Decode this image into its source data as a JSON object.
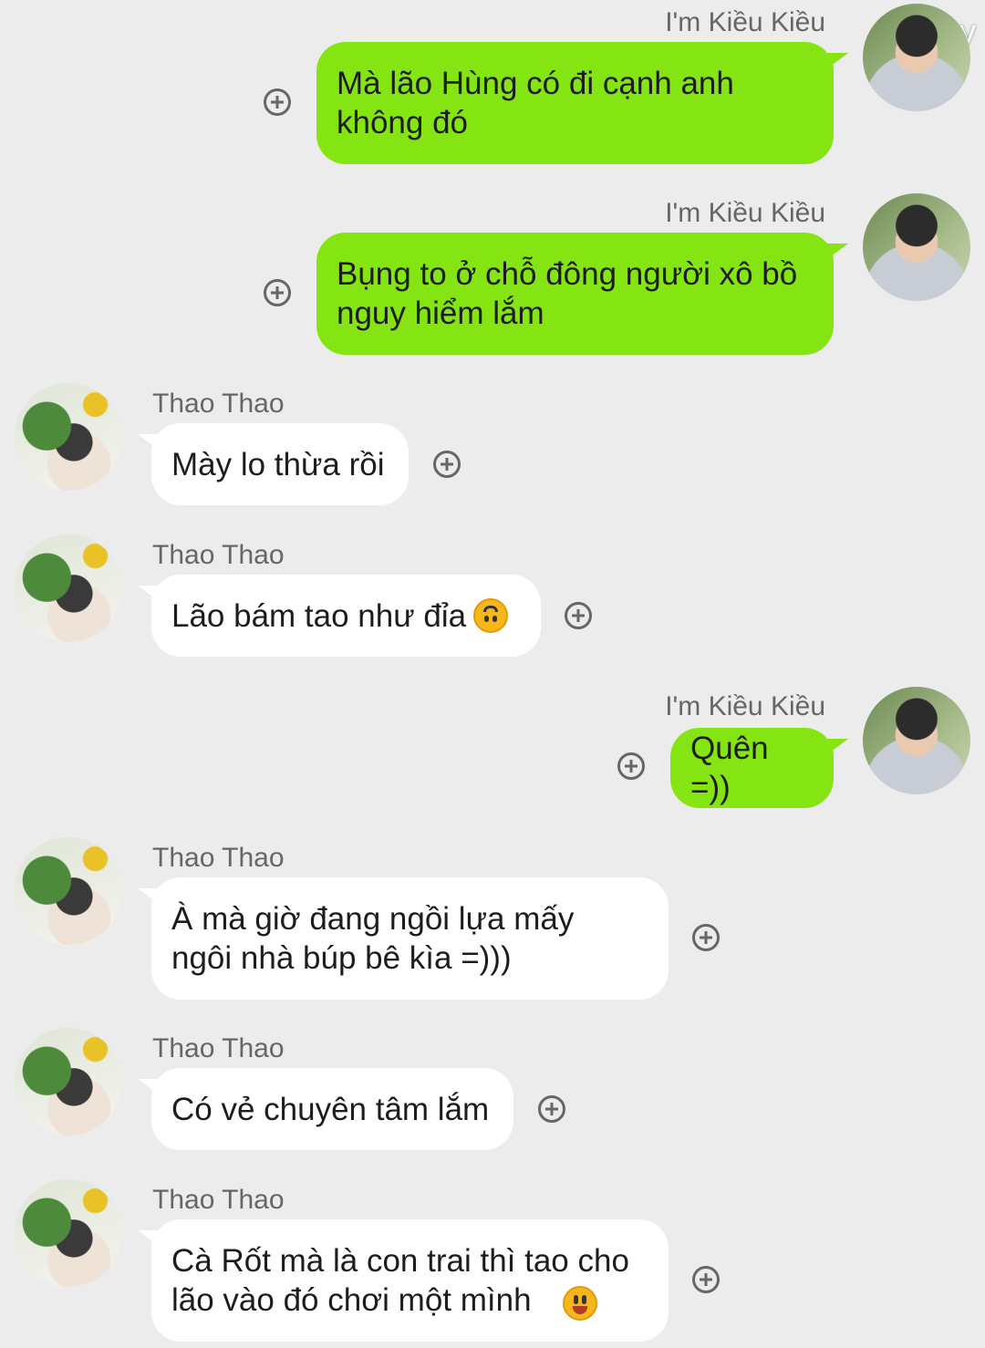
{
  "watermark": "68 joy",
  "messages": [
    {
      "sender": "I'm Kiều Kiều",
      "text": "Mà lão Hùng có đi cạnh anh\nkhông đó"
    },
    {
      "sender": "I'm Kiều Kiều",
      "text": "Bụng to ở chỗ đông người xô bồ\nnguy hiểm lắm"
    },
    {
      "sender": "Thao Thao",
      "text": "Mày lo thừa rồi"
    },
    {
      "sender": "Thao Thao",
      "text": "Lão bám tao như đỉa",
      "emoji": "upside-down-face"
    },
    {
      "sender": "I'm Kiều Kiều",
      "text": "Quên =))"
    },
    {
      "sender": "Thao Thao",
      "text": "À mà giờ đang ngồi lựa mấy\nngôi nhà búp bê kìa =)))"
    },
    {
      "sender": "Thao Thao",
      "text": "Có vẻ chuyên tâm lắm"
    },
    {
      "sender": "Thao Thao",
      "text": "Cà Rốt mà là con trai thì tao cho\nlão vào đó chơi một mình",
      "emoji": "grinning-face"
    }
  ]
}
